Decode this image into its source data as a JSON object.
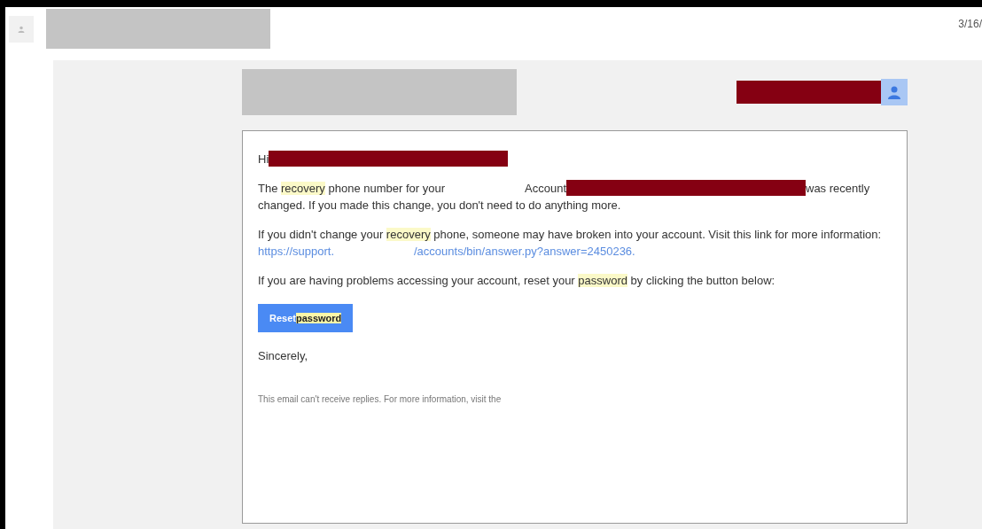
{
  "header": {
    "date": "3/16/"
  },
  "email": {
    "greeting": [
      {
        "kind": "text",
        "text": "Hi"
      },
      {
        "kind": "redaction"
      }
    ],
    "paragraphs": [
      [
        {
          "kind": "text",
          "text": "The "
        },
        {
          "kind": "highlight",
          "text": "recovery"
        },
        {
          "kind": "text",
          "text": " phone number for your"
        },
        {
          "kind": "gap"
        },
        {
          "kind": "text",
          "text": "Account"
        },
        {
          "kind": "redaction"
        },
        {
          "kind": "text",
          "text": "was recently changed. If you made this change, you don't need to do anything more."
        }
      ],
      [
        {
          "kind": "text",
          "text": "If you didn't change your "
        },
        {
          "kind": "highlight",
          "text": "recovery"
        },
        {
          "kind": "text",
          "text": " phone, someone may have broken into your account. Visit this link for more information: "
        },
        {
          "kind": "link",
          "text": "https://support."
        },
        {
          "kind": "gap"
        },
        {
          "kind": "link",
          "text": "/accounts/bin/answer.py?answer="
        },
        {
          "kind": "link",
          "text": "2450236."
        }
      ],
      [
        {
          "kind": "text",
          "text": "If you are having problems accessing your account, reset your "
        },
        {
          "kind": "highlight",
          "text": "password"
        },
        {
          "kind": "text",
          "text": " by clicking the button below:"
        }
      ]
    ],
    "button": [
      {
        "kind": "text",
        "text": "Reset"
      },
      {
        "kind": "highlight",
        "text": "password"
      }
    ],
    "closing": "Sincerely,",
    "footer": "This email can't receive replies. For more information, visit the"
  }
}
